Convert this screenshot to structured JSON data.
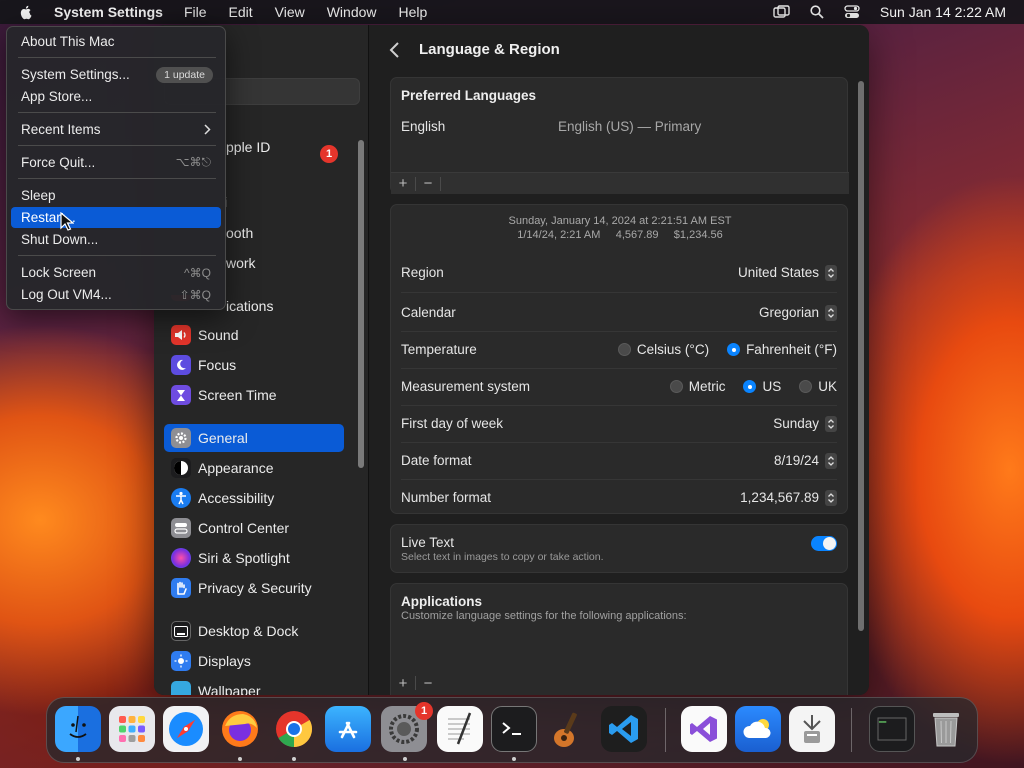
{
  "menubar": {
    "app_name": "System Settings",
    "menus": [
      "File",
      "Edit",
      "View",
      "Window",
      "Help"
    ],
    "datetime": "Sun Jan 14  2:22 AM"
  },
  "apple_menu": {
    "about": "About This Mac",
    "system_settings": "System Settings...",
    "update_badge": "1 update",
    "app_store": "App Store...",
    "recent_items": "Recent Items",
    "force_quit": "Force Quit...",
    "force_quit_shortcut": "⌥⌘⎋",
    "sleep": "Sleep",
    "restart": "Restart...",
    "shut_down": "Shut Down...",
    "lock_screen": "Lock Screen",
    "lock_shortcut": "^⌘Q",
    "log_out": "Log Out VM4...",
    "logout_shortcut": "⇧⌘Q"
  },
  "sidebar": {
    "apple_id_partial": "pple ID",
    "apple_id_badge": "1",
    "wifi_partial": "i",
    "bluetooth_partial": "ooth",
    "network_partial": "work",
    "notifications_partial": "ications",
    "items": [
      {
        "label": "Sound",
        "icon": "sound-icon",
        "color": "#e5352b"
      },
      {
        "label": "Focus",
        "icon": "focus-moon-icon",
        "color": "#5d4ce0"
      },
      {
        "label": "Screen Time",
        "icon": "hourglass-icon",
        "color": "#6e4ce0"
      },
      {
        "label": "General",
        "icon": "gear-icon",
        "color": "#8e8e93"
      },
      {
        "label": "Appearance",
        "icon": "appearance-icon",
        "color": "#1c1c1e"
      },
      {
        "label": "Accessibility",
        "icon": "accessibility-icon",
        "color": "#1a7cf0"
      },
      {
        "label": "Control Center",
        "icon": "control-center-icon",
        "color": "#8e8e93"
      },
      {
        "label": "Siri & Spotlight",
        "icon": "siri-icon",
        "color": "#c23bd4"
      },
      {
        "label": "Privacy & Security",
        "icon": "hand-icon",
        "color": "#2f7cf0"
      },
      {
        "label": "Desktop & Dock",
        "icon": "dock-icon",
        "color": "#1c1c1e"
      },
      {
        "label": "Displays",
        "icon": "sun-icon",
        "color": "#2f7cf0"
      },
      {
        "label": "Wallpaper",
        "icon": "wallpaper-icon",
        "color": "#35a8e0"
      }
    ]
  },
  "content": {
    "title": "Language & Region",
    "preferred_languages": {
      "heading": "Preferred Languages",
      "language": "English",
      "language_detail": "English (US) — Primary",
      "add": "+",
      "remove": "−"
    },
    "preview": {
      "line1": "Sunday, January 14, 2024 at 2:21:51 AM EST",
      "line2": "1/14/24, 2:21 AM     4,567.89     $1,234.56"
    },
    "region": {
      "label": "Region",
      "value": "United States"
    },
    "calendar": {
      "label": "Calendar",
      "value": "Gregorian"
    },
    "temperature": {
      "label": "Temperature",
      "option1": "Celsius (°C)",
      "option2": "Fahrenheit (°F)",
      "selected": "Fahrenheit (°F)"
    },
    "measurement": {
      "label": "Measurement system",
      "option1": "Metric",
      "option2": "US",
      "option3": "UK",
      "selected": "US"
    },
    "first_day": {
      "label": "First day of week",
      "value": "Sunday"
    },
    "date_format": {
      "label": "Date format",
      "value": "8/19/24"
    },
    "number_format": {
      "label": "Number format",
      "value": "1,234,567.89"
    },
    "live_text": {
      "label": "Live Text",
      "description": "Select text in images to copy or take action.",
      "enabled": true
    },
    "applications": {
      "heading": "Applications",
      "description": "Customize language settings for the following applications:",
      "add": "+",
      "remove": "−"
    }
  },
  "dock": {
    "apps": [
      "Finder",
      "Launchpad",
      "Safari",
      "Firefox",
      "Chrome",
      "App Store",
      "System Settings",
      "TextEdit",
      "Terminal",
      "GarageBand",
      "VS Code",
      "Visual Studio",
      "Weather",
      "Archive Utility",
      "Activity Monitor",
      "Trash"
    ],
    "settings_badge": "1"
  }
}
